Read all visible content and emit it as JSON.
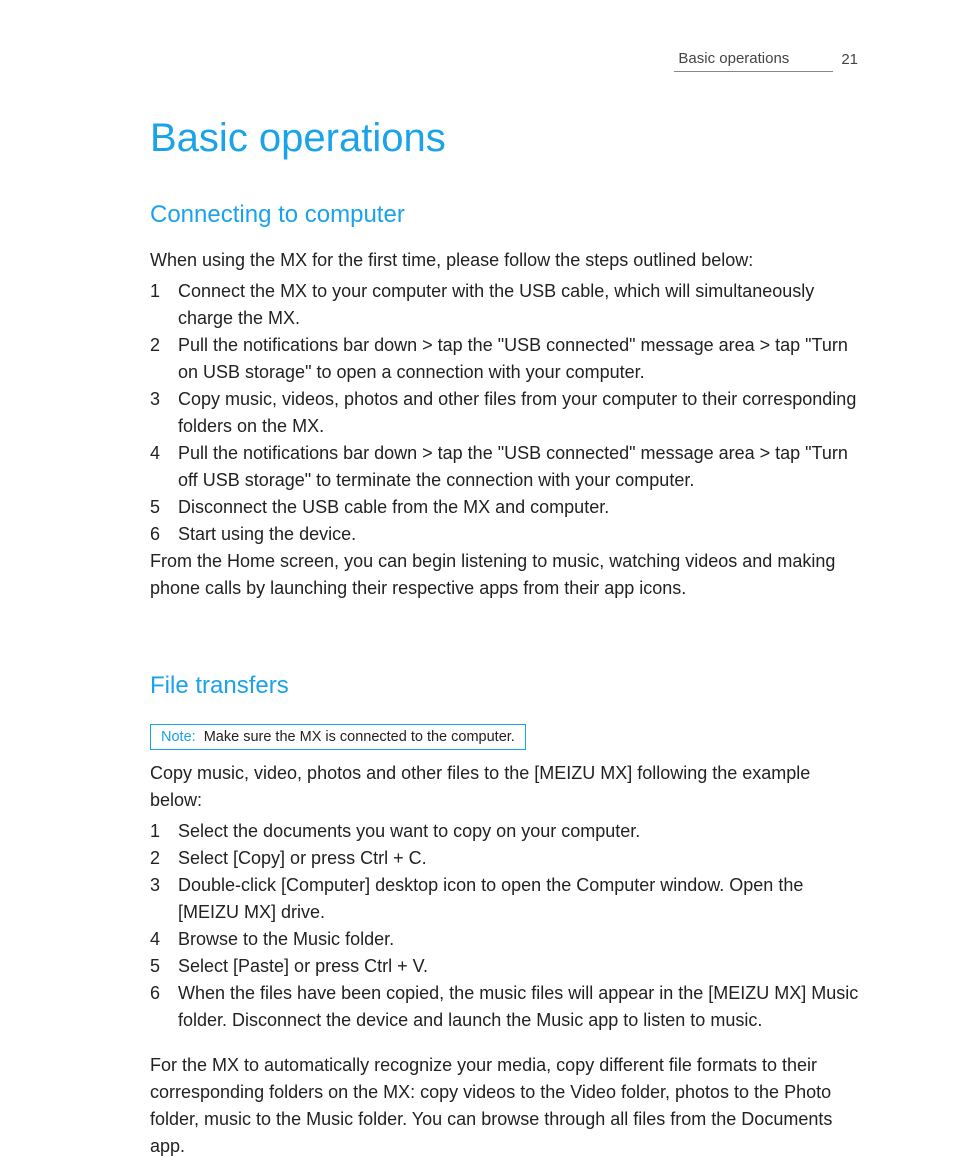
{
  "header": {
    "running_title": "Basic operations",
    "page_number": "21"
  },
  "title": "Basic operations",
  "section1": {
    "heading": "Connecting to computer",
    "intro": "When using the MX for the first time, please follow the steps outlined below:",
    "steps": [
      "Connect the MX to your computer with the USB cable, which will simultaneously charge the MX.",
      "Pull the notifications bar down > tap the \"USB connected\" message area > tap \"Turn on USB storage\" to open a connection with your computer.",
      "Copy music, videos, photos and other files from your computer to their corresponding folders on the MX.",
      "Pull the notifications bar down > tap the \"USB connected\" message area > tap \"Turn off USB storage\" to terminate the connection with your computer.",
      "Disconnect the USB cable from the MX and computer.",
      "Start using the device."
    ],
    "outro": "From the Home screen, you can begin listening to music, watching videos and making phone calls by launching their respective apps from their app icons."
  },
  "section2": {
    "heading": "File transfers",
    "note_label": "Note:",
    "note_text": "Make sure the MX is connected to the computer.",
    "intro": "Copy music, video, photos and other files to the [MEIZU MX] following the example below:",
    "steps": [
      "Select the documents you want to copy on your computer.",
      "Select [Copy] or press Ctrl + C.",
      "Double-click [Computer] desktop icon to open the Computer window. Open the [MEIZU MX] drive.",
      "Browse to the Music folder.",
      "Select [Paste] or press Ctrl + V.",
      "When the files have been copied, the music files will appear in the [MEIZU MX] Music folder. Disconnect the device and launch the Music app to listen to music."
    ],
    "outro": "For the MX to automatically recognize your media, copy different file formats to their corresponding folders on the MX: copy videos to the Video folder, photos to the Photo folder, music to the Music folder. You can browse through all files from the Documents app."
  }
}
